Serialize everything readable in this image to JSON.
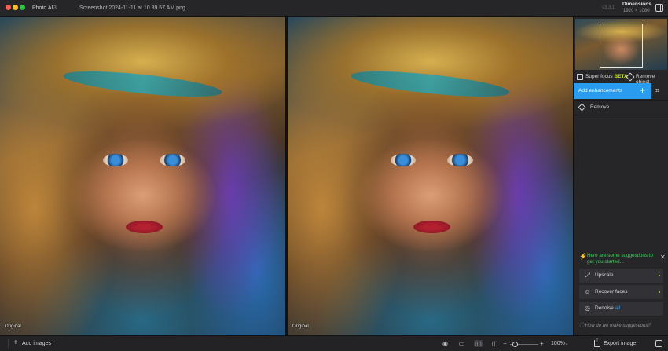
{
  "titlebar": {
    "app_name": "Photo AI",
    "app_version": "3",
    "file_name": "Screenshot 2024-11-11 at 10.39.57 AM.png",
    "window_version": "v3.3.1",
    "dimensions_title": "Dimensions",
    "dimensions_value": "1920 × 1080"
  },
  "viewer": {
    "left_caption": "Original",
    "right_caption": "Original"
  },
  "panel": {
    "super_focus_label": "Super focus",
    "super_focus_badge": "BETA",
    "remove_object_label": "Remove object",
    "add_enhancements_label": "Add enhancements",
    "add_enhancements_plus": "+",
    "remove_label": "Remove",
    "suggestions_header": "Here are some suggestions to get you started...",
    "suggestions": [
      {
        "label": "Upscale",
        "icon": "expand-arrows-icon"
      },
      {
        "label": "Recover faces",
        "icon": "face-icon"
      },
      {
        "label": "Denoise",
        "tag": "all",
        "icon": "denoise-icon"
      }
    ],
    "how_link": "How do we make suggestions?"
  },
  "bottombar": {
    "add_images_label": "Add images",
    "zoom_value": "100%",
    "zoom_level": 0.1,
    "export_label": "Export image"
  },
  "colors": {
    "accent": "#2a9cf0",
    "suggestion_green": "#39d15a",
    "beta_yellow": "#c9e024"
  }
}
